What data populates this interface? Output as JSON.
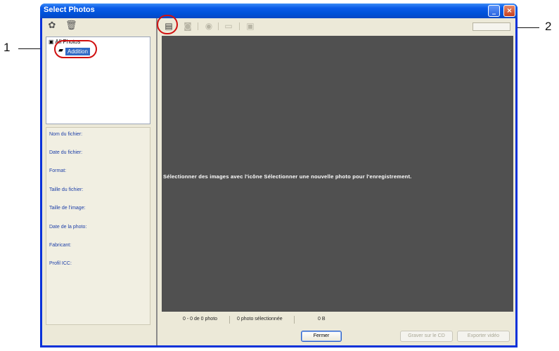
{
  "window": {
    "title": "Select Photos"
  },
  "callouts": {
    "one": "1",
    "two": "2"
  },
  "left_toolbar": {
    "settings_icon": "gear-icon",
    "delete_icon": "trash-icon"
  },
  "tree": {
    "root_label": "All Photos",
    "selected_item": "Addition"
  },
  "info_labels": [
    "Nom du fichier:",
    "Date du fichier:",
    "Format:",
    "Taille du fichier:",
    "Taille de l'image:",
    "Date de la photo:",
    "Fabricant:",
    "Profil ICC:"
  ],
  "viewer": {
    "message": "Sélectionner des images avec l'icône Sélectionner une nouvelle photo pour l'enregistrement."
  },
  "status": {
    "count": "0 - 0 de 0 photo",
    "selected": "0 photo sélectionnée",
    "size": "0 B"
  },
  "buttons": {
    "close": "Fermer",
    "burn_cd": "Graver sur le CD",
    "export_video": "Exporter vidéo"
  },
  "colors": {
    "accent": "#0831d9",
    "callout": "#d01010",
    "viewer_bg": "#505050"
  }
}
